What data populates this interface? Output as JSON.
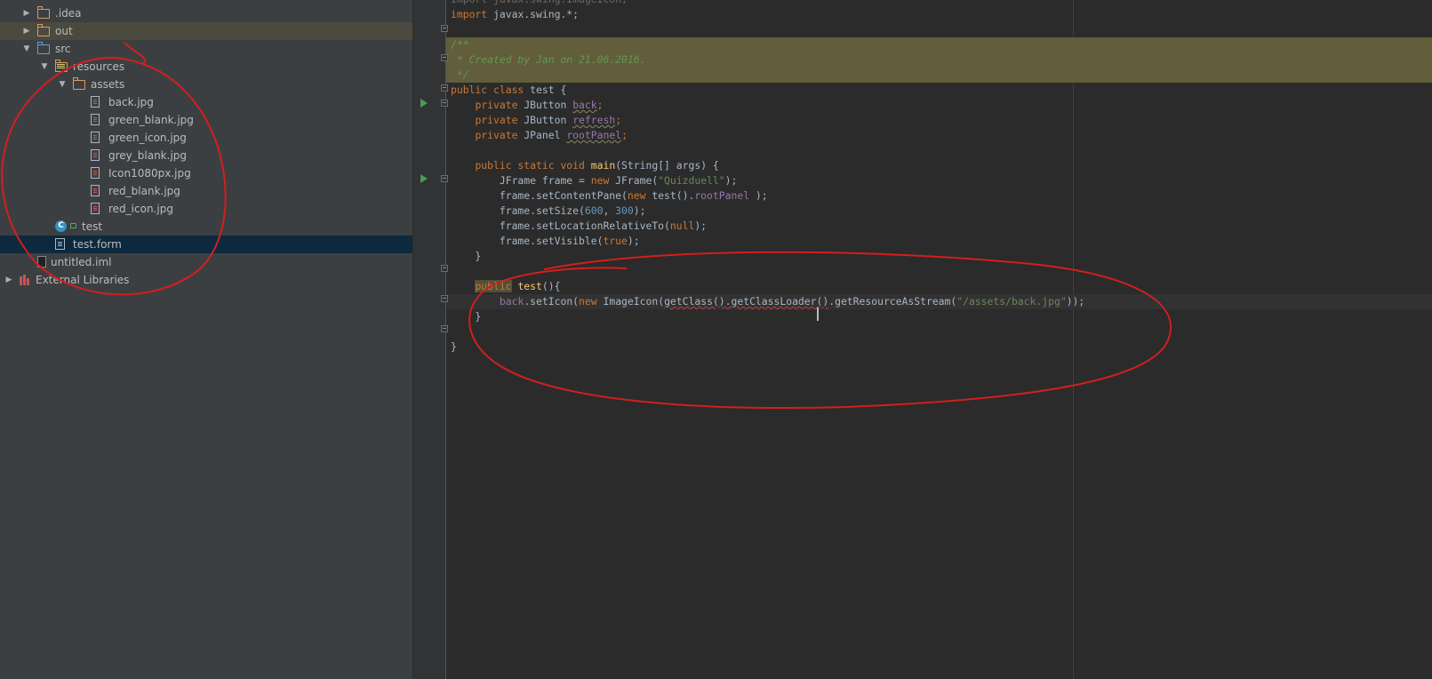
{
  "project_tree": {
    "items": [
      {
        "label": ".idea",
        "depth": 1,
        "arrow": "collapsed",
        "icon": "folder-icon"
      },
      {
        "label": "out",
        "depth": 1,
        "arrow": "collapsed",
        "icon": "folder-icon",
        "highlighted": true
      },
      {
        "label": "src",
        "depth": 1,
        "arrow": "expanded",
        "icon": "source-folder-icon"
      },
      {
        "label": "resources",
        "depth": 2,
        "arrow": "expanded",
        "icon": "resources-folder-icon"
      },
      {
        "label": "assets",
        "depth": 3,
        "arrow": "expanded",
        "icon": "folder-icon"
      },
      {
        "label": "back.jpg",
        "depth": 4,
        "icon": "image-file-icon"
      },
      {
        "label": "green_blank.jpg",
        "depth": 4,
        "icon": "image-file-icon"
      },
      {
        "label": "green_icon.jpg",
        "depth": 4,
        "icon": "image-file-icon"
      },
      {
        "label": "grey_blank.jpg",
        "depth": 4,
        "icon": "image-file-icon"
      },
      {
        "label": "Icon1080px.jpg",
        "depth": 4,
        "icon": "image-file-icon"
      },
      {
        "label": "red_blank.jpg",
        "depth": 4,
        "icon": "image-file-icon"
      },
      {
        "label": "red_icon.jpg",
        "depth": 4,
        "icon": "image-file-icon"
      },
      {
        "label": "test",
        "depth": 2,
        "icon": "java-class-icon"
      },
      {
        "label": "test.form",
        "depth": 2,
        "icon": "form-file-icon",
        "selected": true
      },
      {
        "label": "untitled.iml",
        "depth": 1,
        "icon": "module-file-icon"
      },
      {
        "label": "External Libraries",
        "depth": 0,
        "arrow": "collapsed",
        "icon": "libraries-icon"
      }
    ]
  },
  "editor": {
    "lines": [
      {
        "top": "import javax.swing.ImageIcon;"
      },
      {
        "tokens": [
          [
            "kw",
            "import "
          ],
          [
            "",
            "javax.swing.*;"
          ]
        ]
      },
      {
        "tokens": []
      },
      {
        "tokens": [
          [
            "cm",
            "/**"
          ]
        ],
        "doc": true
      },
      {
        "tokens": [
          [
            "cm",
            " * Created by Jan on 21.06.2016."
          ]
        ],
        "doc": true
      },
      {
        "tokens": [
          [
            "cm",
            " */"
          ]
        ],
        "doc": true
      },
      {
        "tokens": [
          [
            "kw",
            "public class "
          ],
          [
            "",
            "test {"
          ]
        ]
      },
      {
        "tokens": [
          [
            "",
            "    "
          ],
          [
            "kw",
            "private "
          ],
          [
            "",
            "JButton "
          ],
          [
            "fld warn",
            "back"
          ],
          [
            "kw",
            ";"
          ]
        ]
      },
      {
        "tokens": [
          [
            "",
            "    "
          ],
          [
            "kw",
            "private "
          ],
          [
            "",
            "JButton "
          ],
          [
            "fld warn",
            "refresh"
          ],
          [
            "kw",
            ";"
          ]
        ]
      },
      {
        "tokens": [
          [
            "",
            "    "
          ],
          [
            "kw",
            "private "
          ],
          [
            "",
            "JPanel "
          ],
          [
            "fld warn",
            "rootPanel"
          ],
          [
            "kw",
            ";"
          ]
        ]
      },
      {
        "tokens": []
      },
      {
        "tokens": [
          [
            "",
            "    "
          ],
          [
            "kw",
            "public static void "
          ],
          [
            "fn",
            "main"
          ],
          [
            "",
            "(String[] args) {"
          ]
        ]
      },
      {
        "tokens": [
          [
            "",
            "        JFrame frame = "
          ],
          [
            "kw",
            "new "
          ],
          [
            "",
            "JFrame("
          ],
          [
            "st",
            "\"Quizduell\""
          ],
          [
            "",
            "); "
          ]
        ]
      },
      {
        "tokens": [
          [
            "",
            "        frame.setContentPane("
          ],
          [
            "kw",
            "new "
          ],
          [
            "",
            "test()."
          ],
          [
            "fld",
            "rootPanel"
          ],
          [
            "",
            " );"
          ]
        ]
      },
      {
        "tokens": [
          [
            "",
            "        frame.setSize("
          ],
          [
            "num",
            "600"
          ],
          [
            "",
            ", "
          ],
          [
            "num",
            "300"
          ],
          [
            "",
            ");"
          ]
        ]
      },
      {
        "tokens": [
          [
            "",
            "        frame.setLocationRelativeTo("
          ],
          [
            "kw",
            "null"
          ],
          [
            "",
            ");"
          ]
        ]
      },
      {
        "tokens": [
          [
            "",
            "        frame.setVisible("
          ],
          [
            "kw",
            "true"
          ],
          [
            "",
            ");"
          ]
        ]
      },
      {
        "tokens": [
          [
            "",
            "    }"
          ]
        ]
      },
      {
        "tokens": []
      },
      {
        "tokens": [
          [
            "",
            "    "
          ],
          [
            "kw ctor-hl",
            "public"
          ],
          [
            "",
            " "
          ],
          [
            "fn",
            "test"
          ],
          [
            "",
            "(){"
          ]
        ]
      },
      {
        "tokens": [
          [
            "",
            "        "
          ],
          [
            "fld",
            "back"
          ],
          [
            "",
            ".setIcon("
          ],
          [
            "kw",
            "new "
          ],
          [
            "",
            "ImageIcon("
          ],
          [
            "err",
            "getClass().getClassLoader()"
          ],
          [
            "",
            ".getResourceAsStream("
          ],
          [
            "st",
            "\"/assets/back.jpg\""
          ],
          [
            "",
            "));"
          ]
        ],
        "caret": true
      },
      {
        "tokens": [
          [
            "",
            "    }"
          ]
        ]
      },
      {
        "tokens": []
      },
      {
        "tokens": [
          [
            "",
            "}"
          ]
        ]
      }
    ]
  },
  "colors": {
    "sidebar_bg": "#3c3f41",
    "editor_bg": "#2b2b2b",
    "keyword": "#cc7832",
    "string": "#6a8759",
    "number": "#6897bb",
    "comment": "#629755",
    "field": "#9876aa",
    "method": "#ffc66d",
    "selection": "#0d293e",
    "annotation": "#d21f1f"
  }
}
